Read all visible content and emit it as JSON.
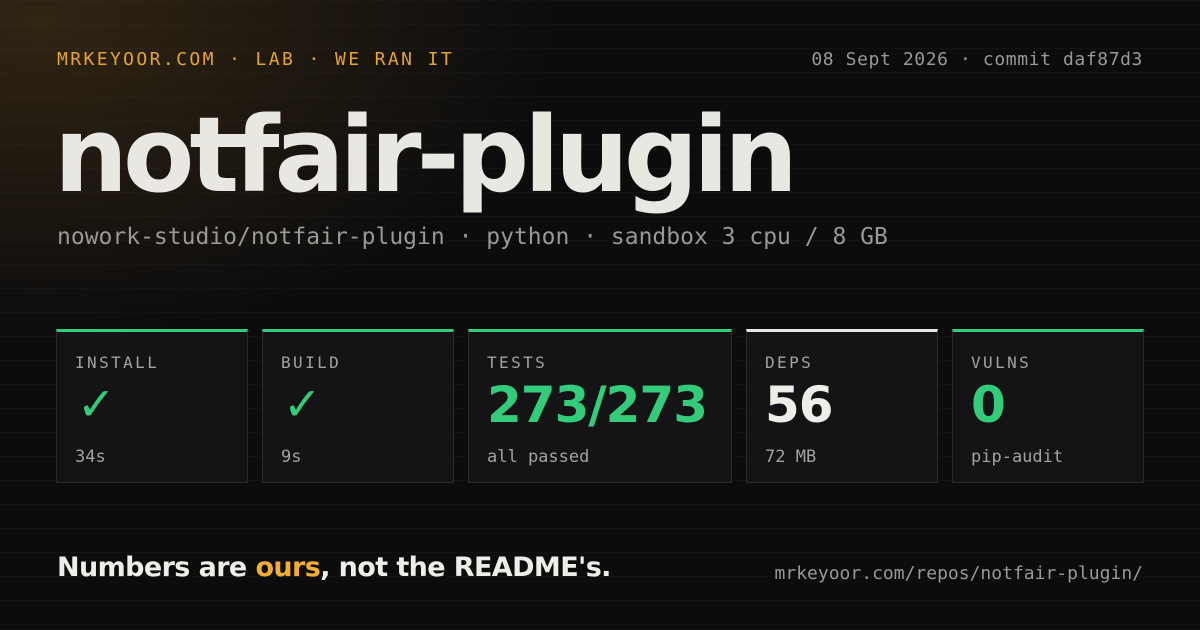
{
  "header": {
    "kicker": "MRKEYOOR.COM · LAB · WE RAN IT",
    "meta": "08 Sept 2026 · commit daf87d3"
  },
  "repo": {
    "name": "notfair-plugin",
    "subline": "nowork-studio/notfair-plugin · python · sandbox 3 cpu / 8 GB"
  },
  "cards": [
    {
      "label": "INSTALL",
      "value": "✓",
      "sub": "34s",
      "status": "pass",
      "accent": "#33cc7a"
    },
    {
      "label": "BUILD",
      "value": "✓",
      "sub": "9s",
      "status": "pass",
      "accent": "#33cc7a"
    },
    {
      "label": "TESTS",
      "value": "273/273",
      "sub": "all passed",
      "status": "pass",
      "accent": "#33cc7a"
    },
    {
      "label": "DEPS",
      "value": "56",
      "sub": "72 MB",
      "status": "neutral",
      "accent": "#e7e5df"
    },
    {
      "label": "VULNS",
      "value": "0",
      "sub": "pip-audit",
      "status": "pass",
      "accent": "#33cc7a"
    }
  ],
  "footer": {
    "tagline_before": "Numbers are ",
    "tagline_accent": "ours",
    "tagline_after": ", not the README's.",
    "url": "mrkeyoor.com/repos/notfair-plugin/"
  },
  "colors": {
    "background": "#0c0c0d",
    "accent_orange": "#e5a52b",
    "pass_green": "#33cc7a",
    "text_primary": "#e9e7e1",
    "text_muted": "#9a9894"
  }
}
